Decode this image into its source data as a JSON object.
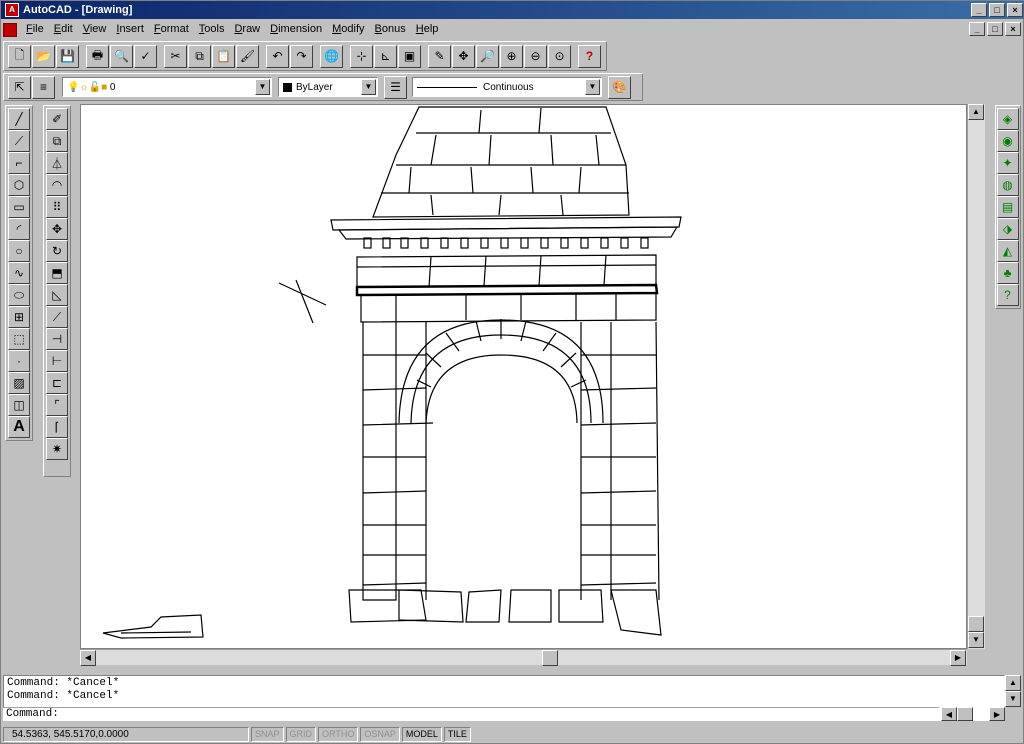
{
  "window": {
    "title": "AutoCAD - [Drawing]"
  },
  "menu": [
    "File",
    "Edit",
    "View",
    "Insert",
    "Format",
    "Tools",
    "Draw",
    "Dimension",
    "Modify",
    "Bonus",
    "Help"
  ],
  "layer_toolbar": {
    "layer": "0",
    "color": "ByLayer",
    "linetype": "Continuous"
  },
  "command": {
    "history": [
      "Command: *Cancel*",
      "Command: *Cancel*"
    ],
    "prompt": "Command:"
  },
  "status": {
    "coords": "54.5363, 545.5170,0.0000",
    "buttons": [
      "SNAP",
      "GRID",
      "ORTHO",
      "OSNAP",
      "MODEL",
      "TILE"
    ],
    "on": [
      "MODEL",
      "TILE"
    ]
  }
}
